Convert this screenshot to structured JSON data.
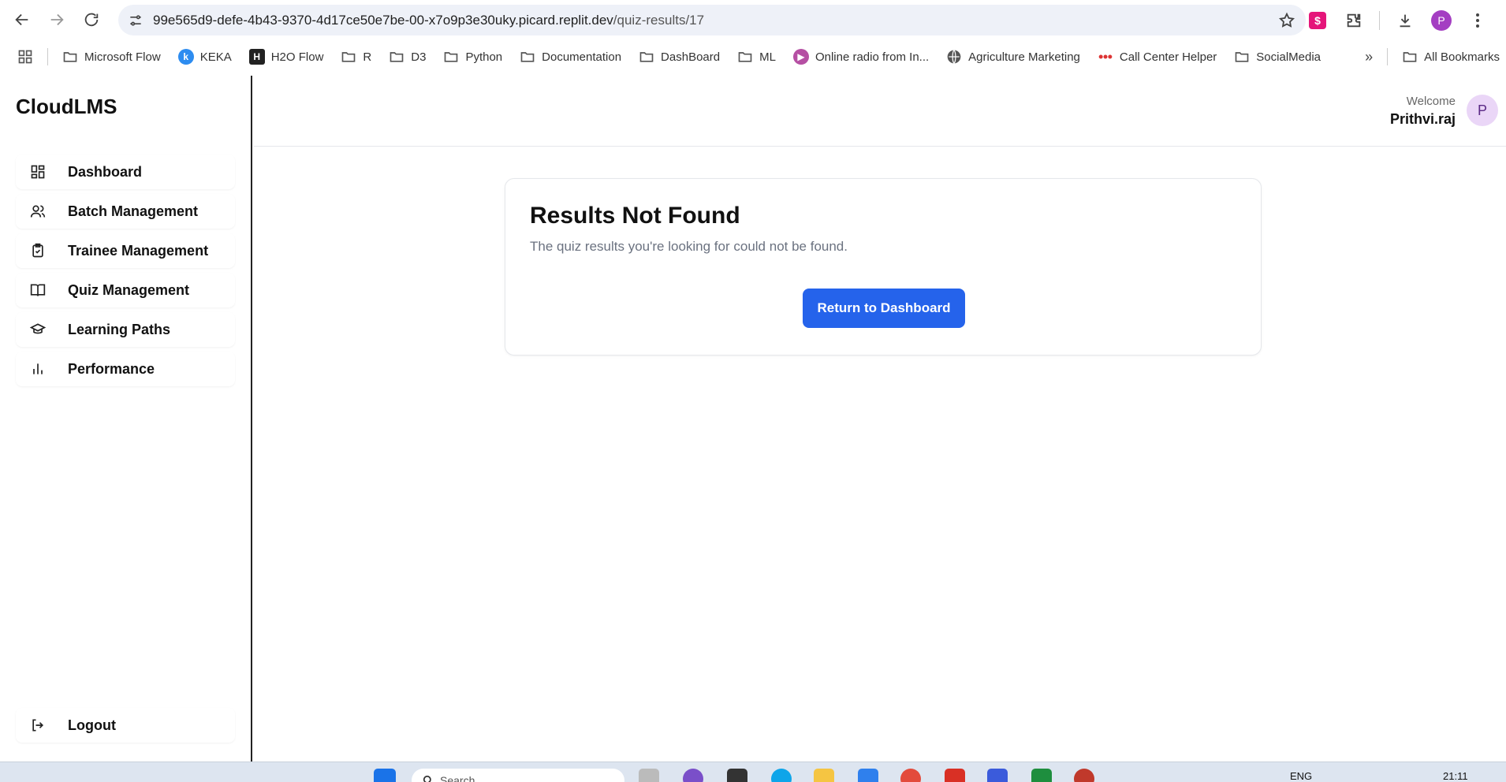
{
  "browser": {
    "url_host": "99e565d9-defe-4b43-9370-4d17ce50e7be-00-x7o9p3e30uky.picard.replit.dev",
    "url_path": "/quiz-results/17",
    "profile_initial": "P"
  },
  "bookmarks": {
    "items": [
      {
        "label": "Microsoft Flow",
        "icon": "folder-icon"
      },
      {
        "label": "KEKA",
        "icon": "keka-icon"
      },
      {
        "label": "H2O Flow",
        "icon": "h2o-icon"
      },
      {
        "label": "R",
        "icon": "folder-icon"
      },
      {
        "label": "D3",
        "icon": "folder-icon"
      },
      {
        "label": "Python",
        "icon": "folder-icon"
      },
      {
        "label": "Documentation",
        "icon": "folder-icon"
      },
      {
        "label": "DashBoard",
        "icon": "folder-icon"
      },
      {
        "label": "ML",
        "icon": "folder-icon"
      },
      {
        "label": "Online radio from In...",
        "icon": "radio-icon"
      },
      {
        "label": "Agriculture Marketing",
        "icon": "globe-icon"
      },
      {
        "label": "Call Center Helper",
        "icon": "dots-icon"
      },
      {
        "label": "SocialMedia",
        "icon": "folder-icon"
      }
    ],
    "more": "»",
    "all_bookmarks": "All Bookmarks"
  },
  "app": {
    "brand": "CloudLMS",
    "nav": [
      {
        "label": "Dashboard",
        "icon": "grid-icon"
      },
      {
        "label": "Batch Management",
        "icon": "users-icon"
      },
      {
        "label": "Trainee Management",
        "icon": "clipboard-icon"
      },
      {
        "label": "Quiz Management",
        "icon": "book-icon"
      },
      {
        "label": "Learning Paths",
        "icon": "graduation-cap-icon"
      },
      {
        "label": "Performance",
        "icon": "bar-chart-icon"
      }
    ],
    "logout": "Logout",
    "header": {
      "welcome": "Welcome",
      "username": "Prithvi.raj",
      "avatar_initial": "P"
    },
    "card": {
      "title": "Results Not Found",
      "description": "The quiz results you're looking for could not be found.",
      "button": "Return to Dashboard"
    }
  },
  "taskbar": {
    "search_placeholder": "Search",
    "language": "ENG",
    "time": "21:11"
  },
  "colors": {
    "accent": "#2563eb",
    "avatar_bg": "#ead6f7"
  }
}
